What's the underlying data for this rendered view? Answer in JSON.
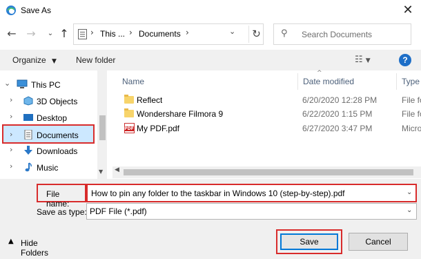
{
  "window": {
    "title": "Save As"
  },
  "address": {
    "segments": [
      "This ...",
      "Documents"
    ]
  },
  "search": {
    "placeholder": "Search Documents"
  },
  "toolbar": {
    "organize": "Organize",
    "new_folder": "New folder"
  },
  "tree": {
    "items": [
      {
        "label": "This PC",
        "icon": "pc-icon"
      },
      {
        "label": "3D Objects",
        "icon": "cube-icon"
      },
      {
        "label": "Desktop",
        "icon": "desktop-icon"
      },
      {
        "label": "Documents",
        "icon": "documents-icon"
      },
      {
        "label": "Downloads",
        "icon": "download-icon"
      },
      {
        "label": "Music",
        "icon": "music-icon"
      }
    ]
  },
  "files": {
    "columns": [
      "Name",
      "Date modified",
      "Type"
    ],
    "rows": [
      {
        "name": "Reflect",
        "date": "6/20/2020 12:28 PM",
        "type": "File fo",
        "icon": "folder-icon"
      },
      {
        "name": "Wondershare Filmora 9",
        "date": "6/22/2020 1:15 PM",
        "type": "File fo",
        "icon": "folder-icon"
      },
      {
        "name": "My PDF.pdf",
        "date": "6/27/2020 3:47 PM",
        "type": "Micro",
        "icon": "pdf-icon"
      }
    ]
  },
  "form": {
    "file_name_label": "File name:",
    "file_name_value": "How to pin any folder to the taskbar in Windows 10 (step-by-step).pdf",
    "save_as_type_label": "Save as type:",
    "save_as_type_value": "PDF File (*.pdf)"
  },
  "footer": {
    "hide_folders": "Hide Folders",
    "save": "Save",
    "cancel": "Cancel"
  },
  "colors": {
    "accent": "#0078d7",
    "highlight": "#d82b2b",
    "selection": "#cce8ff"
  }
}
